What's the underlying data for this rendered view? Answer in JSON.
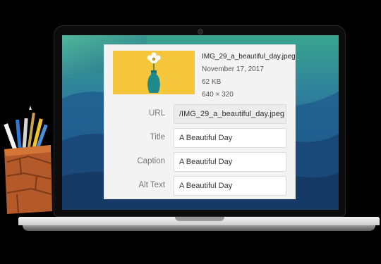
{
  "attachment": {
    "filename": "IMG_29_a_beautiful_day.jpeg",
    "date": "November 17, 2017",
    "filesize": "62 KB",
    "dimensions": "640 × 320"
  },
  "form": {
    "url_label": "URL",
    "url_value": "/IMG_29_a_beautiful_day.jpeg",
    "title_label": "Title",
    "title_value": "A Beautiful Day",
    "caption_label": "Caption",
    "caption_value": "A Beautiful Day",
    "alt_label": "Alt Text",
    "alt_value": "A Beautiful Day"
  },
  "colors": {
    "thumbnail_background": "#f5c63c",
    "vase": "#1f8a8c",
    "screen_wave_dark": "#1d4f7a",
    "screen_wave_light": "#3fb08f"
  },
  "icons": [
    "laptop-camera-icon",
    "flower-vase-image",
    "pencil-cup-illustration"
  ]
}
